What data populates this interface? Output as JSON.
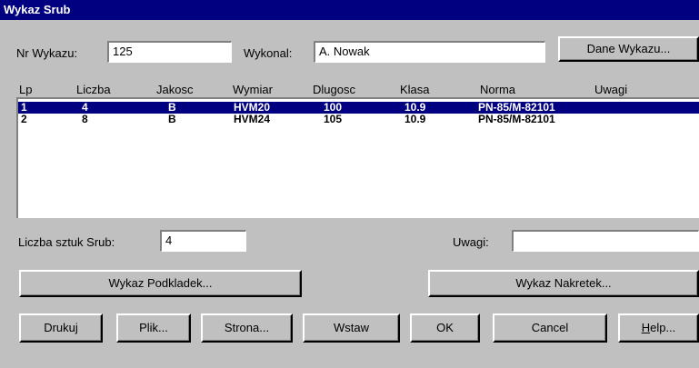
{
  "window": {
    "title": "Wykaz Srub"
  },
  "header": {
    "nr_wykazu_label": "Nr Wykazu:",
    "nr_wykazu_value": "125",
    "wykonal_label": "Wykonal:",
    "wykonal_value": "A. Nowak",
    "dane_button": "Dane Wykazu..."
  },
  "table": {
    "columns": [
      "Lp",
      "Liczba",
      "Jakosc",
      "Wymiar",
      "Dlugosc",
      "Klasa",
      "Norma",
      "Uwagi"
    ],
    "rows": [
      {
        "lp": "1",
        "liczba": "4",
        "jakosc": "B",
        "wymiar": "HVM20",
        "dlugosc": "100",
        "klasa": "10.9",
        "norma": "PN-85/M-82101",
        "uwagi": "",
        "selected": true
      },
      {
        "lp": "2",
        "liczba": "8",
        "jakosc": "B",
        "wymiar": "HVM24",
        "dlugosc": "105",
        "klasa": "10.9",
        "norma": "PN-85/M-82101",
        "uwagi": "",
        "selected": false
      }
    ]
  },
  "detail": {
    "liczba_label": "Liczba sztuk Srub:",
    "liczba_value": "4",
    "uwagi_label": "Uwagi:",
    "uwagi_value": ""
  },
  "buttons": {
    "podkladek": "Wykaz Podkladek...",
    "nakretek": "Wykaz Nakretek...",
    "drukuj": "Drukuj",
    "plik": "Plik...",
    "strona": "Strona...",
    "wstaw": "Wstaw",
    "ok": "OK",
    "cancel": "Cancel",
    "help_underlined": "H",
    "help_rest": "elp..."
  },
  "colors": {
    "title_bar": "#000080",
    "face": "#c0c0c0",
    "selection": "#000080"
  }
}
